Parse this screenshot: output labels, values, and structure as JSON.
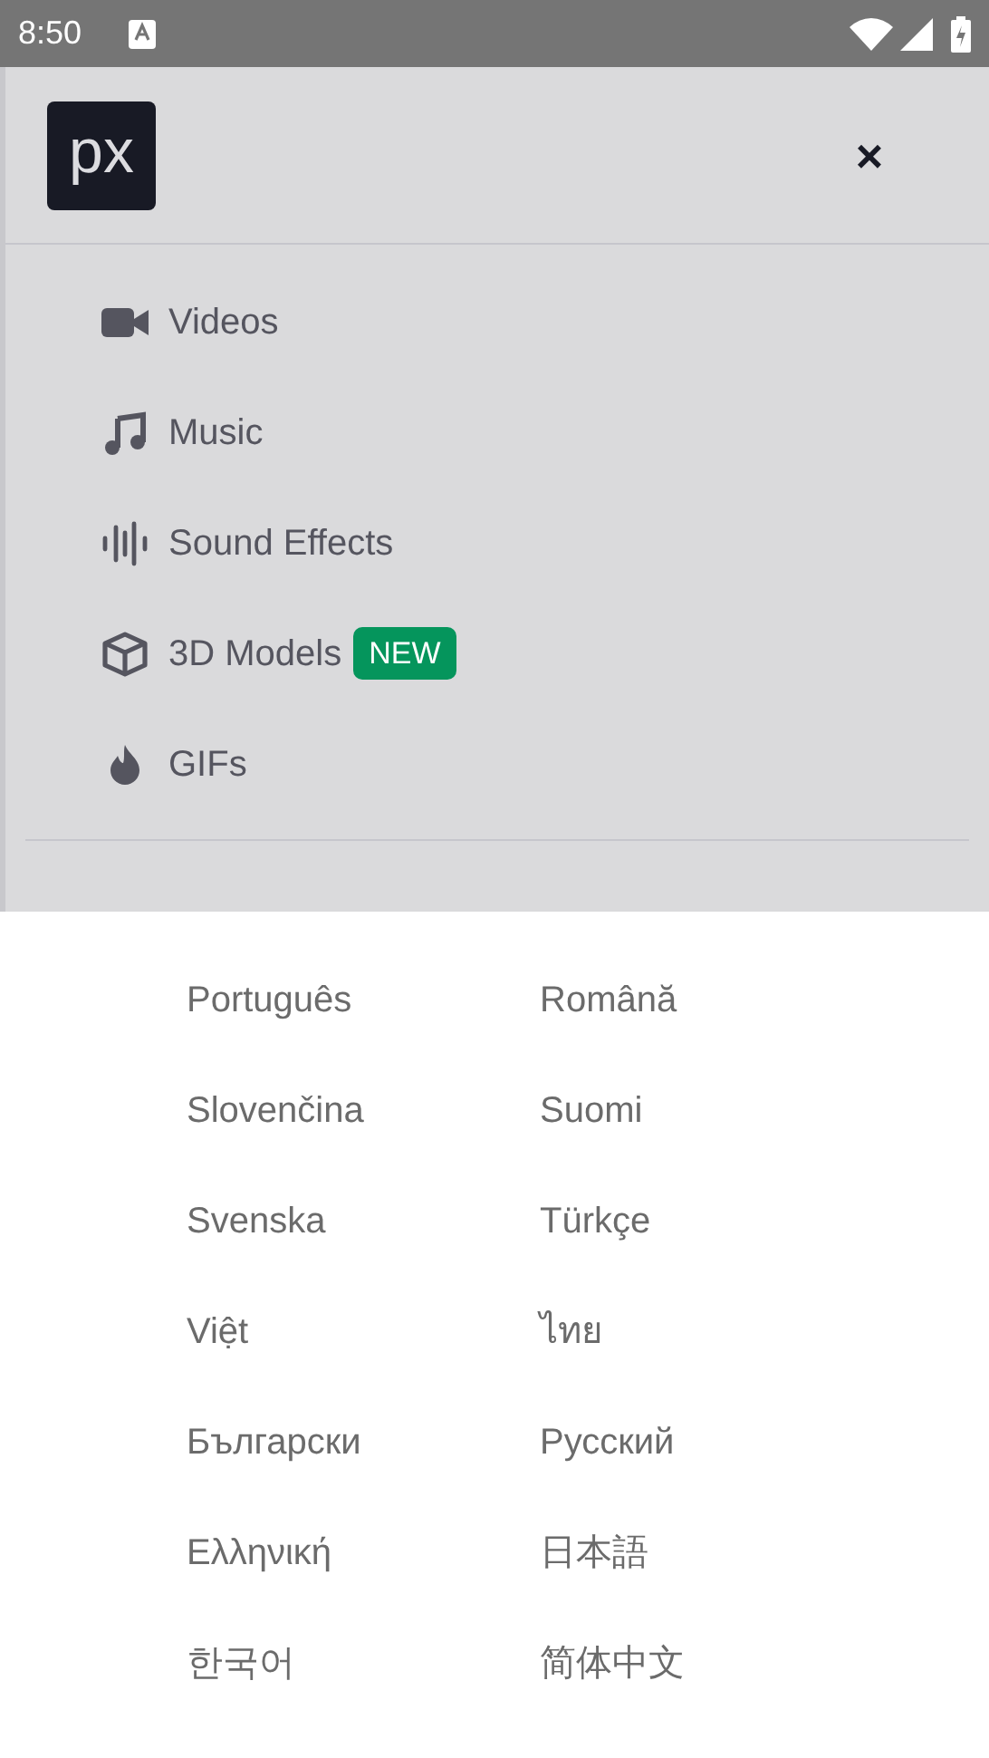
{
  "status_bar": {
    "time": "8:50"
  },
  "menu": {
    "logo": "px",
    "close": "×",
    "items": [
      {
        "kind": "video",
        "label": "Videos"
      },
      {
        "kind": "music",
        "label": "Music"
      },
      {
        "kind": "sound",
        "label": "Sound Effects"
      },
      {
        "kind": "cube",
        "label": "3D Models",
        "badge": "NEW"
      },
      {
        "kind": "flame",
        "label": "GIFs"
      }
    ]
  },
  "languages": [
    {
      "label": "Português"
    },
    {
      "label": "Română"
    },
    {
      "label": "Slovenčina"
    },
    {
      "label": "Suomi"
    },
    {
      "label": "Svenska"
    },
    {
      "label": "Türkçe"
    },
    {
      "label": "Việt"
    },
    {
      "label": "ไทย"
    },
    {
      "label": "Български"
    },
    {
      "label": "Русский"
    },
    {
      "label": "Ελληνική"
    },
    {
      "label": "日本語"
    },
    {
      "label": "한국어"
    },
    {
      "label": "简体中文"
    }
  ]
}
